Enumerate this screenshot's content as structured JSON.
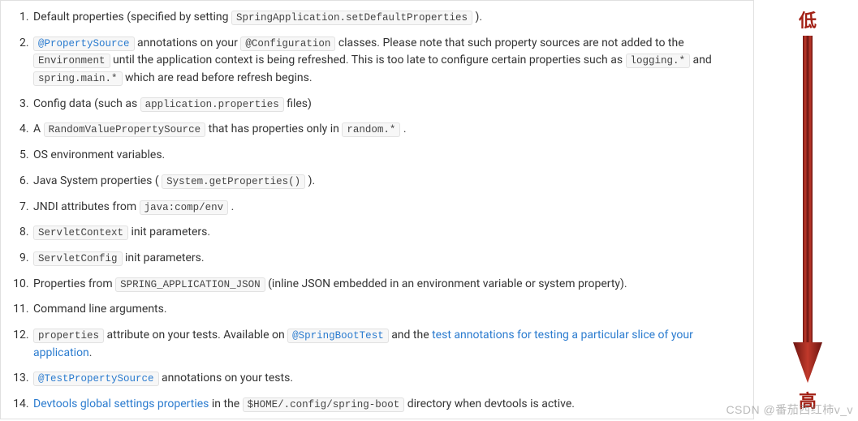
{
  "arrow": {
    "top_label": "低",
    "bottom_label": "高"
  },
  "watermark": "CSDN @番茄西红柿v_v",
  "list": {
    "i1": {
      "t1": "Default properties (specified by setting ",
      "c1": "SpringApplication.setDefaultProperties",
      "t2": " )."
    },
    "i2": {
      "c1": "@PropertySource",
      "t1": " annotations on your ",
      "c2": "@Configuration",
      "t2": " classes. Please note that such property sources are not added to the ",
      "c3": "Environment",
      "t3": " until the application context is being refreshed. This is too late to configure certain properties such as ",
      "c4": "logging.*",
      "t4": " and ",
      "c5": "spring.main.*",
      "t5": " which are read before refresh begins."
    },
    "i3": {
      "t1": "Config data (such as ",
      "c1": "application.properties",
      "t2": " files)"
    },
    "i4": {
      "t1": "A ",
      "c1": "RandomValuePropertySource",
      "t2": " that has properties only in ",
      "c2": "random.*",
      "t3": " ."
    },
    "i5": {
      "t1": "OS environment variables."
    },
    "i6": {
      "t1": "Java System properties ( ",
      "c1": "System.getProperties()",
      "t2": " )."
    },
    "i7": {
      "t1": "JNDI attributes from ",
      "c1": "java:comp/env",
      "t2": " ."
    },
    "i8": {
      "c1": "ServletContext",
      "t1": " init parameters."
    },
    "i9": {
      "c1": "ServletConfig",
      "t1": " init parameters."
    },
    "i10": {
      "t1": "Properties from ",
      "c1": "SPRING_APPLICATION_JSON",
      "t2": " (inline JSON embedded in an environment variable or system property)."
    },
    "i11": {
      "t1": "Command line arguments."
    },
    "i12": {
      "c1": "properties",
      "t1": " attribute on your tests. Available on ",
      "c2": "@SpringBootTest",
      "t2": " and the ",
      "l1": "test annotations for testing a particular slice of your application",
      "t3": "."
    },
    "i13": {
      "c1": "@TestPropertySource",
      "t1": " annotations on your tests."
    },
    "i14": {
      "l1": "Devtools global settings properties",
      "t1": " in the ",
      "c1": "$HOME/.config/spring-boot",
      "t2": " directory when devtools is active."
    }
  }
}
